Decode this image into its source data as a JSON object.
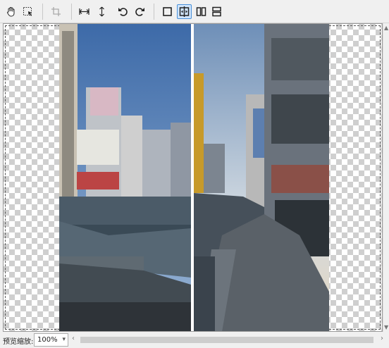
{
  "toolbar": {
    "buttons": [
      {
        "name": "hand-tool-button",
        "icon": "hand-icon"
      },
      {
        "name": "select-tool-button",
        "icon": "marquee-select-icon"
      },
      {
        "name": "crop-tool-button",
        "icon": "crop-icon",
        "disabled": true
      },
      {
        "name": "fit-width-button",
        "icon": "horizontal-arrows-icon"
      },
      {
        "name": "fit-height-button",
        "icon": "vertical-arrows-icon"
      },
      {
        "name": "rotate-left-button",
        "icon": "rotate-left-icon"
      },
      {
        "name": "rotate-right-button",
        "icon": "rotate-right-icon"
      },
      {
        "name": "view-single-button",
        "icon": "single-view-icon"
      },
      {
        "name": "view-split-button",
        "icon": "split-compare-icon",
        "active": true
      },
      {
        "name": "view-side-by-side-button",
        "icon": "side-by-side-icon"
      },
      {
        "name": "view-stacked-button",
        "icon": "stacked-view-icon"
      }
    ]
  },
  "status": {
    "zoom_label": "预览缩放:",
    "zoom_value": "100%"
  },
  "colors": {
    "active": "#4a90d9",
    "checker": "#cfcfcf",
    "divider": "#ffffff"
  }
}
